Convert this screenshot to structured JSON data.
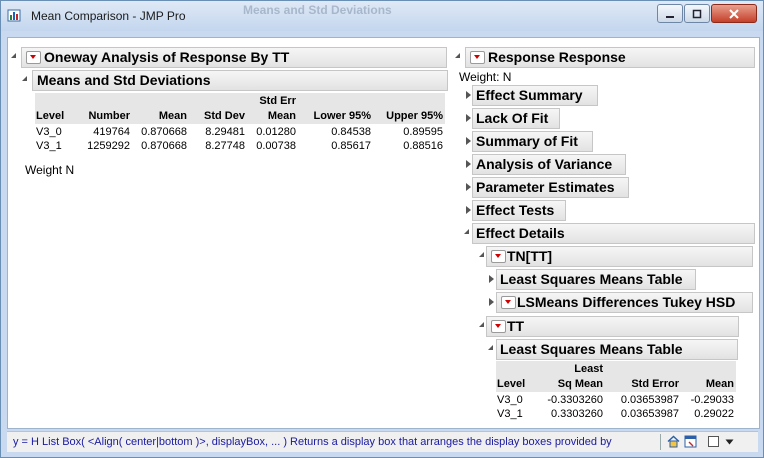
{
  "window": {
    "title": "Mean Comparison - JMP Pro",
    "background_title": "Means and Std Deviations"
  },
  "left": {
    "main_header": "Oneway Analysis of Response By TT",
    "sub_header": "Means and Std Deviations",
    "table": {
      "columns": [
        "Level",
        "Number",
        "Mean",
        "Std Dev",
        "Std Err Mean",
        "Lower 95%",
        "Upper 95%"
      ],
      "col_stderr_top": "Std Err",
      "col_stderr_bottom": "Mean",
      "rows": [
        [
          "V3_0",
          "419764",
          "0.870668",
          "8.29481",
          "0.01280",
          "0.84538",
          "0.89595"
        ],
        [
          "V3_1",
          "1259292",
          "0.870668",
          "8.27748",
          "0.00738",
          "0.85617",
          "0.88516"
        ]
      ]
    },
    "weight_label": "Weight  N"
  },
  "right": {
    "main_header": "Response Response",
    "weight_label": "Weight: N",
    "collapsed_reports": [
      "Effect Summary",
      "Lack Of Fit",
      "Summary of Fit",
      "Analysis of Variance",
      "Parameter Estimates",
      "Effect Tests"
    ],
    "effect_details": "Effect Details",
    "tn_header": "TN[TT]",
    "tn_items": [
      "Least Squares Means Table",
      "LSMeans Differences Tukey HSD"
    ],
    "tt_header": "TT",
    "lsm_header": "Least Squares Means Table",
    "lsm_table": {
      "col_level": "Level",
      "col_lsm_top": "Least",
      "col_lsm_bottom": "Sq Mean",
      "col_stderr": "Std Error",
      "col_mean": "Mean",
      "rows": [
        [
          "V3_0",
          "-0.3303260",
          "0.03653987",
          "-0.29033"
        ],
        [
          "V3_1",
          "0.3303260",
          "0.03653987",
          "0.29022"
        ]
      ]
    }
  },
  "status": {
    "text": "y = H List Box( <Align( center|bottom )>, displayBox, ... )  Returns a display box that arranges the display boxes provided by"
  },
  "colors": {
    "red_triangle": "#d10000",
    "status_text": "#1a1aa0"
  }
}
